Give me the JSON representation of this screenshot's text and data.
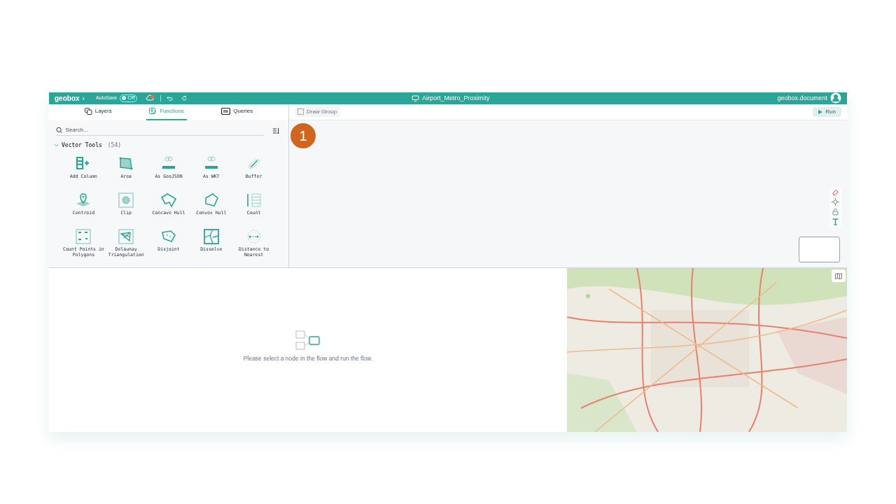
{
  "header": {
    "logo": "geobox",
    "logo_caret": "›",
    "autosave_label": "AutoSave",
    "autosave": {
      "on": false,
      "label": "Off"
    },
    "title": "Airport_Metro_Proximity",
    "user": "geobox.document"
  },
  "tabs": [
    {
      "label": "Layers",
      "selected": false
    },
    {
      "label": "Functions",
      "selected": true
    },
    {
      "label": "Queries",
      "selected": false
    }
  ],
  "search": {
    "placeholder": "Search..."
  },
  "group": {
    "title": "Vector Tools",
    "count": "(54)",
    "expanded": true
  },
  "tools": [
    {
      "label": "Add Column"
    },
    {
      "label": "Area"
    },
    {
      "label": "As GeoJSON"
    },
    {
      "label": "As WKT"
    },
    {
      "label": "Buffer"
    },
    {
      "label": "Centroid"
    },
    {
      "label": "Clip"
    },
    {
      "label": "Concave Hull"
    },
    {
      "label": "Convex Hull"
    },
    {
      "label": "Count"
    },
    {
      "label": "Count Points in Polygons"
    },
    {
      "label": "Delaunay Triangulation"
    },
    {
      "label": "Disjoint"
    },
    {
      "label": "Dissolve"
    },
    {
      "label": "Distance to Nearest"
    }
  ],
  "canvas": {
    "draw_group": "Draw Group",
    "run": "Run",
    "step_marker": "1"
  },
  "result": {
    "message": "Please select a node in the flow and run the flow."
  }
}
